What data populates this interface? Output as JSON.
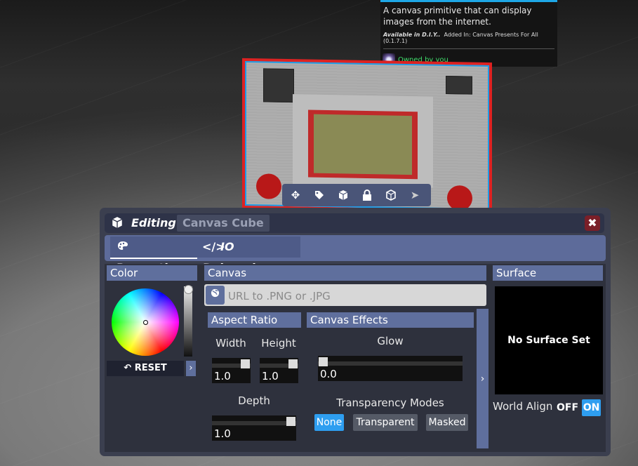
{
  "tooltip": {
    "description": "A canvas primitive that can display images from the internet.",
    "available_label": "Available in D.I.Y..",
    "added_in": "Added In: Canvas Presents For All (0.1.7.1)",
    "owner": "Owned by you"
  },
  "gizmo": {
    "icons": [
      "move-icon",
      "tag-icon",
      "box-icon",
      "lock-icon",
      "cube-icon",
      "pointer-icon"
    ]
  },
  "panel": {
    "title": "Editing",
    "object_name": "Canvas Cube",
    "close_label": "✖"
  },
  "tabs": [
    {
      "label": "Properties",
      "icon": "palette-icon",
      "active": true
    },
    {
      "label": "IO Debugging",
      "icon": "code-icon",
      "active": false
    }
  ],
  "color": {
    "header": "Color",
    "reset_label": "RESET",
    "expand_label": "›"
  },
  "canvas": {
    "header": "Canvas",
    "url_placeholder": "URL to .PNG or .JPG",
    "url_value": ""
  },
  "aspect": {
    "header": "Aspect Ratio",
    "width_label": "Width",
    "height_label": "Height",
    "depth_label": "Depth",
    "width_value": "1.0",
    "height_value": "1.0",
    "depth_value": "1.0"
  },
  "effects": {
    "header": "Canvas Effects",
    "glow_label": "Glow",
    "glow_value": "0.0",
    "transparency_label": "Transparency Modes",
    "modes": [
      "None",
      "Transparent",
      "Masked"
    ],
    "selected_mode": "None",
    "expand_label": "›"
  },
  "surface": {
    "header": "Surface",
    "preview_text": "No Surface Set",
    "world_align_label": "World Align",
    "off_label": "OFF",
    "on_label": "ON",
    "world_align_on": true
  },
  "colors": {
    "accent": "#2e9ef0",
    "header": "#5f6f9d",
    "panel": "#3b3f4f",
    "close": "#7a1f28",
    "owner_text": "#3fdc6b"
  }
}
